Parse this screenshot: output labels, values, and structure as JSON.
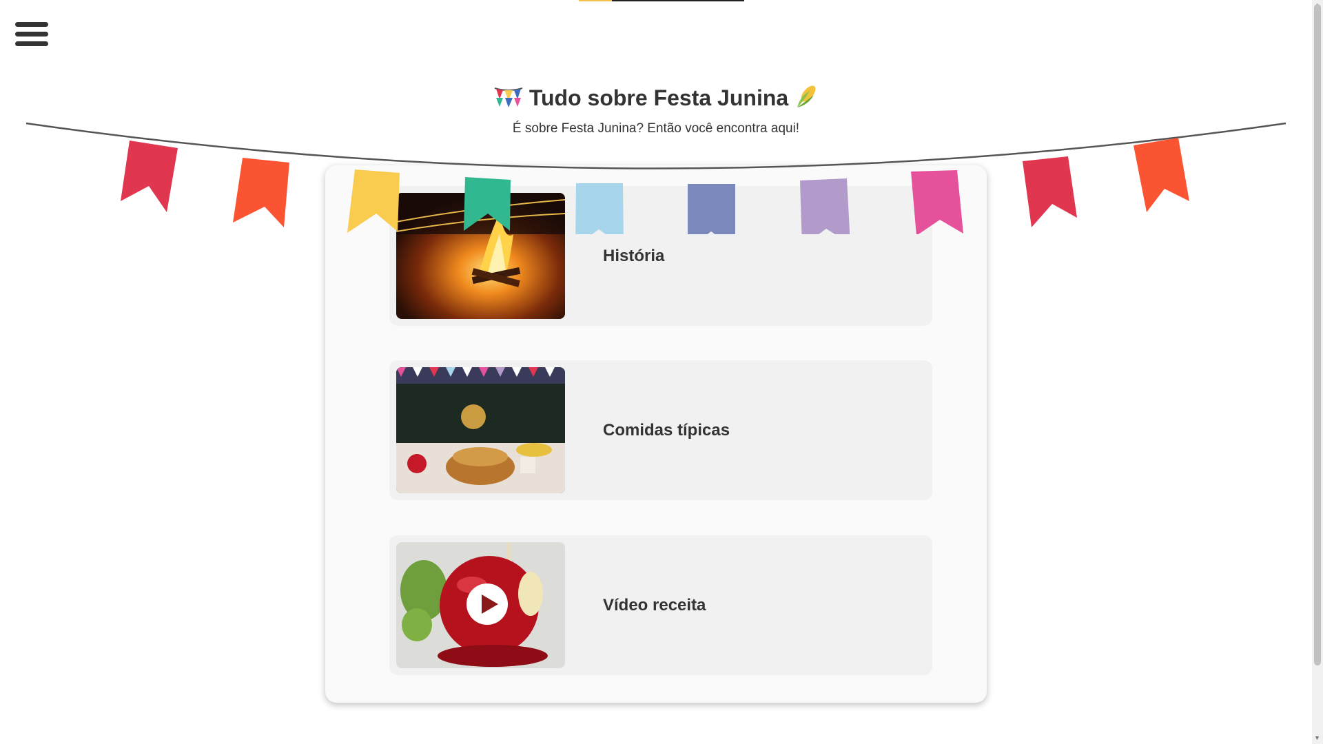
{
  "header": {
    "title": "Tudo sobre Festa Junina",
    "subtitle": "É sobre Festa Junina? Então você encontra aqui!",
    "icons": [
      "bunting-flags-icon",
      "corn-icon"
    ]
  },
  "menu": {
    "icon": "hamburger-menu-icon"
  },
  "page_progress": 0.2,
  "items": [
    {
      "label": "História",
      "image": "bonfire-photo"
    },
    {
      "label": "Comidas típicas",
      "image": "festa-food-table-photo"
    },
    {
      "label": "Vídeo receita",
      "image": "candy-apple-photo",
      "overlay_icon": "play-icon"
    }
  ],
  "colors": {
    "flags": [
      "#e0364f",
      "#fb5432",
      "#f9cc50",
      "#32b890",
      "#a6d5ec",
      "#7c89bd",
      "#b29bcb",
      "#e6519c"
    ],
    "text": "#333333",
    "card_bg": "#fafafa",
    "item_bg": "#f1f1f1"
  }
}
